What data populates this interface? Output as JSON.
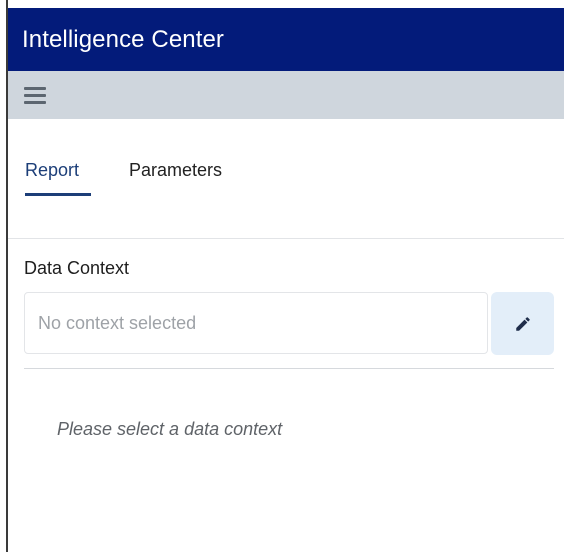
{
  "app": {
    "title": "Intelligence Center"
  },
  "toolbar": {
    "menu_icon": "hamburger-menu-icon"
  },
  "tabs": [
    {
      "label": "Report",
      "active": true
    },
    {
      "label": "Parameters",
      "active": false
    }
  ],
  "data_context": {
    "label": "Data Context",
    "placeholder": "No context selected",
    "edit_icon": "pencil-icon",
    "hint": "Please select a data context"
  },
  "colors": {
    "titlebar_bg": "#031b7a",
    "toolbar_bg": "#cfd6dd",
    "accent": "#1c3e78",
    "edit_button_bg": "#e3eef9"
  }
}
